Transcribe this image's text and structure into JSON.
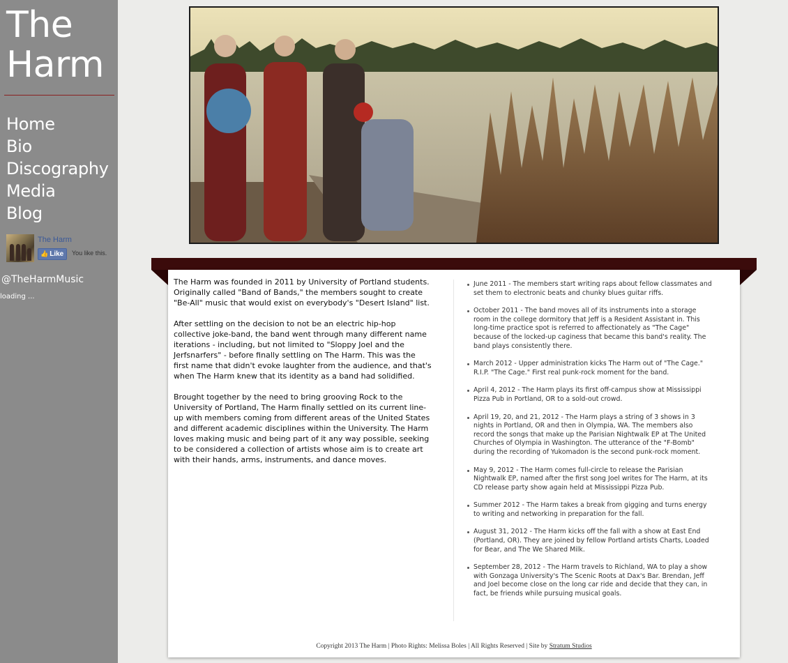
{
  "site": {
    "title_line1": "The",
    "title_line2": "Harm"
  },
  "nav": {
    "items": [
      {
        "label": "Home"
      },
      {
        "label": "Bio"
      },
      {
        "label": "Discography"
      },
      {
        "label": "Media"
      },
      {
        "label": "Blog"
      }
    ]
  },
  "facebook": {
    "page_name": "The Harm",
    "like_label": "Like",
    "like_status": "You like this."
  },
  "twitter": {
    "handle": "@TheHarmMusic",
    "loading": "loading ..."
  },
  "bio": {
    "paragraphs": [
      "The Harm was founded in 2011 by University of Portland students. Originally called \"Band of Bands,\" the members sought to create \"Be-All\" music that would exist on everybody's \"Desert Island\" list.",
      "After settling on the decision to not be an electric hip-hop collective joke-band, the band went through many different name iterations - including, but not limited to \"Sloppy Joel and the Jerfsnarfers\" - before finally settling on The Harm. This was the first name that didn't evoke laughter from the audience, and that's when The Harm knew that its identity as a band had solidified.",
      "Brought together by the need to bring grooving Rock to the University of Portland, The Harm finally settled on its current line-up with members coming from different areas of the United States and different academic disciplines within the University. The Harm loves making music and being part of it any way possible, seeking to be considered a collection of artists whose aim is to create art with their hands, arms, instruments, and dance moves."
    ]
  },
  "timeline": {
    "items": [
      "June 2011 - The members start writing raps about fellow classmates and set them to electronic beats and chunky blues guitar riffs.",
      "October 2011 - The band moves all of its instruments into a storage room in the college dormitory that Jeff is a Resident Assistant in. This long-time practice spot is referred to affectionately as \"The Cage\" because of the locked-up caginess that became this band's reality. The band plays consistently there.",
      "March 2012 - Upper administration kicks The Harm out of \"The Cage.\" R.I.P. \"The Cage.\" First real punk-rock moment for the band.",
      "April 4, 2012 - The Harm plays its first off-campus show at Mississippi Pizza Pub in Portland, OR to a sold-out crowd.",
      "April 19, 20, and 21, 2012 - The Harm plays a string of 3 shows in 3 nights in Portland, OR and then in Olympia, WA. The members also record the songs that make up the Parisian Nightwalk EP at The United Churches of Olympia in Washington. The utterance of the \"F-Bomb\" during the recording of Yukomadon is the second punk-rock moment.",
      "May 9, 2012 - The Harm comes full-circle to release the Parisian Nightwalk EP, named after the first song Joel writes for The Harm, at its CD release party show again held at Mississippi Pizza Pub.",
      "Summer 2012 - The Harm takes a break from gigging and turns energy to writing and networking in preparation for the fall.",
      "August 31, 2012 - The Harm kicks off the fall with a show at East End (Portland, OR). They are joined by fellow Portland artists Charts, Loaded for Bear, and The We Shared Milk.",
      "September 28, 2012 - The Harm travels to Richland, WA to play a show with Gonzaga University's The Scenic Roots at Dax's Bar. Brendan, Jeff and Joel become close on the long car ride and decide that they can, in fact, be friends while pursuing musical goals."
    ]
  },
  "footer": {
    "text": "Copyright 2013 The Harm  |  Photo Rights: Melissa Boles  |  All Rights Reserved  |  Site by ",
    "link_label": "Stratum Studios"
  },
  "colors": {
    "sidebar_bg": "#8b8b8b",
    "ribbon": "#3b0b0b",
    "accent_rule": "#8a1f1f",
    "facebook_blue": "#3b5998"
  }
}
